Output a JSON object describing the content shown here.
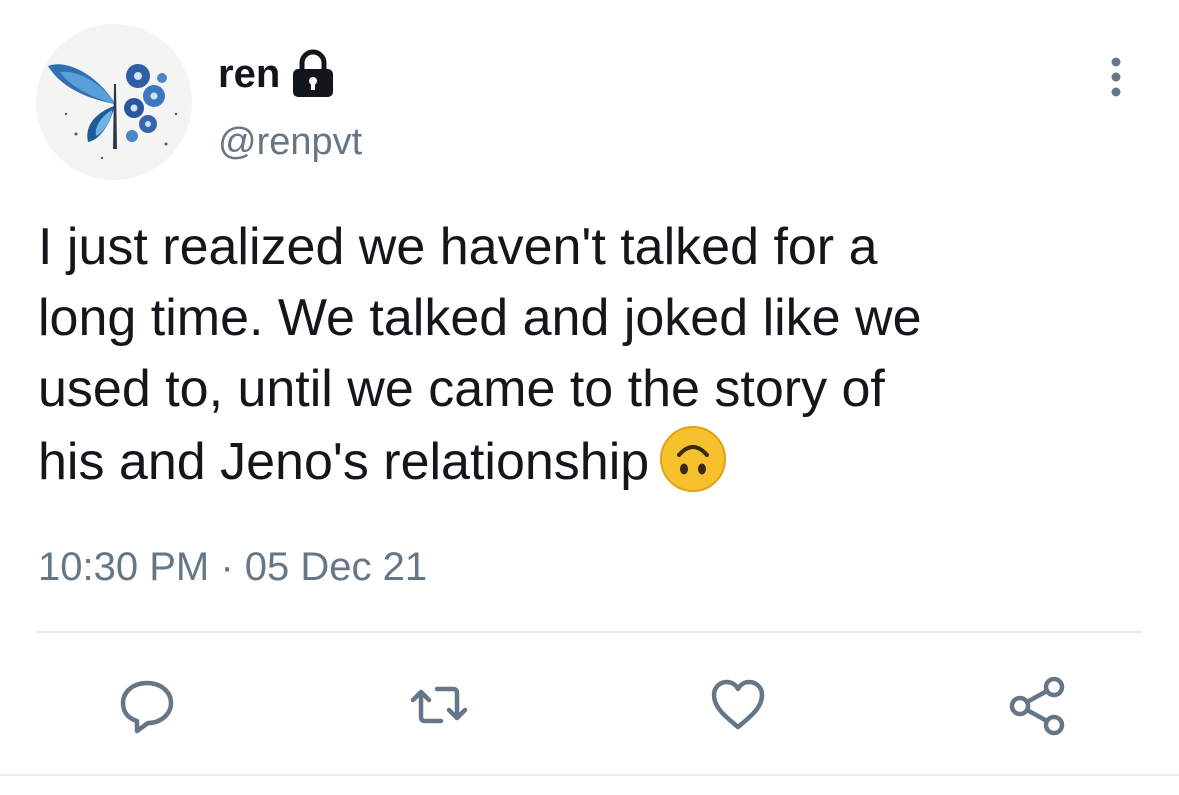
{
  "user": {
    "display_name": "ren",
    "handle": "@renpvt",
    "protected": true,
    "avatar_icon": "blue-butterfly-avatar"
  },
  "tweet": {
    "text_lines": [
      "I just realized we haven't talked for a",
      "long time. We talked and joked like we",
      "used to, until we came to the story of",
      "his and Jeno's relationship"
    ],
    "emoji": "upside-down-face",
    "timestamp": "10:30 PM · 05 Dec 21"
  },
  "actions": [
    {
      "name": "reply",
      "icon": "comment-icon"
    },
    {
      "name": "retweet",
      "icon": "retweet-icon"
    },
    {
      "name": "like",
      "icon": "heart-icon"
    },
    {
      "name": "share",
      "icon": "share-icon"
    }
  ],
  "colors": {
    "text": "#14171a",
    "secondary": "#657786",
    "divider": "#e6ecf0",
    "emoji_face": "#f7c12e"
  }
}
